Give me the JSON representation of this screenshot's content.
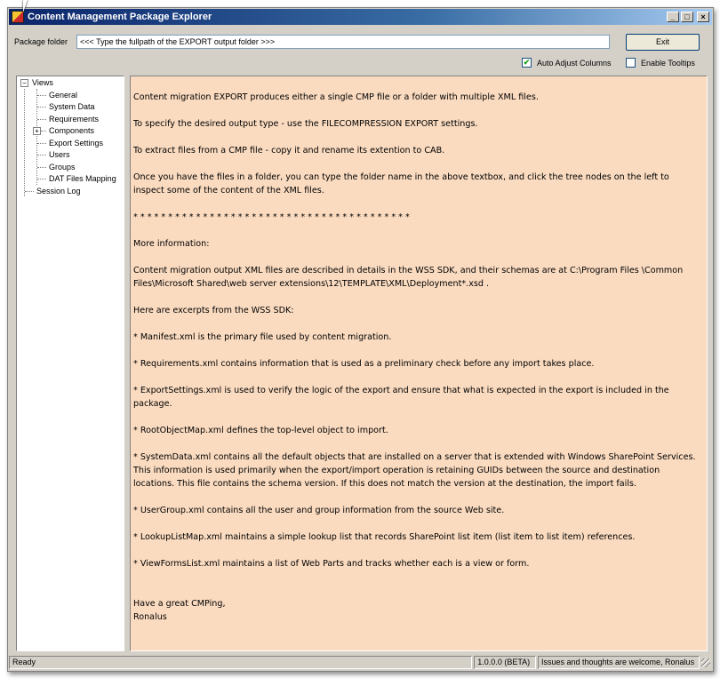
{
  "window": {
    "title": "Content Management Package Explorer",
    "controls": {
      "minimize": "_",
      "maximize": "□",
      "close": "×"
    }
  },
  "toolbar": {
    "package_folder_label": "Package folder",
    "package_folder_value": "<<< Type the fullpath of the EXPORT output folder >>>",
    "exit_label": "Exit",
    "auto_adjust_label": "Auto Adjust Columns",
    "auto_adjust_checked": true,
    "enable_tooltips_label": "Enable Tooltips",
    "enable_tooltips_checked": false
  },
  "tree": {
    "root": "Views",
    "children": [
      "General",
      "System Data",
      "Requirements",
      "Components",
      "Export Settings",
      "Users",
      "Groups",
      "DAT Files Mapping"
    ],
    "session_log": "Session Log"
  },
  "content": {
    "paragraphs": [
      "Content migration EXPORT produces either a single CMP file or a folder with multiple XML files.",
      "To specify the desired output type - use the FILECOMPRESSION EXPORT settings.",
      "To extract files from a CMP file - copy it and rename its extention to CAB.",
      "Once you have the files in a folder, you can type the folder name in the above textbox, and click the tree nodes on the left to inspect some of the content of the XML files.",
      "* * * * * * * * * * * * * * * * * * * * * * * * * * * * * * * * * * * * * * * *",
      "More information:",
      "Content migration output XML files are described in details in the WSS SDK, and their schemas are at C:\\Program Files \\Common Files\\Microsoft Shared\\web server extensions\\12\\TEMPLATE\\XML\\Deployment*.xsd .",
      "Here are excerpts from the WSS SDK:",
      "* Manifest.xml is the primary file used by content migration.",
      "* Requirements.xml contains information that is used as a preliminary check before any import takes place.",
      "* ExportSettings.xml is used to verify the logic of the export and ensure that what is expected in the export is included in the package.",
      "* RootObjectMap.xml defines the top-level object to import.",
      "* SystemData.xml contains all the default objects that are installed on a server that is extended with Windows SharePoint Services. This information is used primarily when the export/import operation is retaining GUIDs between the source and destination locations. This file contains the schema version. If this does not match the version at the destination, the import fails.",
      "* UserGroup.xml contains all the user and group information from the source Web site.",
      "* LookupListMap.xml maintains a simple lookup list that records SharePoint list item (list item to list item) references.",
      "* ViewFormsList.xml maintains a list of Web Parts and tracks whether each is a view or form."
    ],
    "signoff_1": "Have a great CMPing,",
    "signoff_2": "Ronalus"
  },
  "status": {
    "ready": "Ready",
    "version": "1.0.0.0 (BETA)",
    "message": "Issues and thoughts are welcome,  Ronalus"
  },
  "colors": {
    "content_bg": "#fadbc0",
    "title_gradient_start": "#0a246a",
    "window_bg": "#d4d0c8"
  }
}
